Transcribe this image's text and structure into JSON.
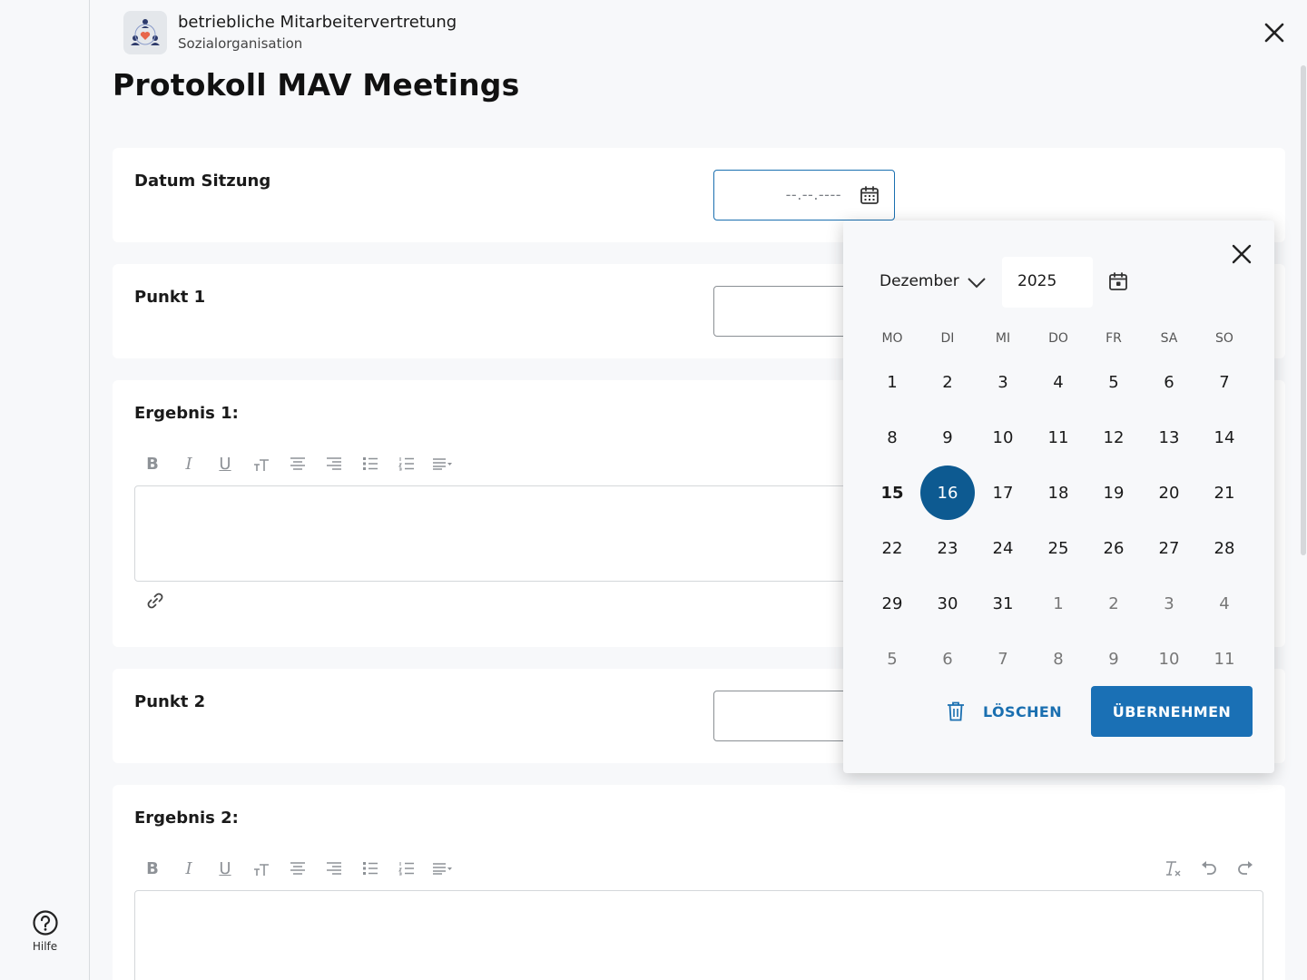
{
  "header": {
    "app_name": "betriebliche Mitarbeitervertretung",
    "app_subtitle": "Sozialorganisation",
    "page_title": "Protokoll MAV Meetings"
  },
  "sidebar": {
    "help_label": "Hilfe"
  },
  "form": {
    "date_label": "Datum Sitzung",
    "date_placeholder": "--.--.----",
    "punkt1_label": "Punkt 1",
    "ergebnis1_label": "Ergebnis 1:",
    "punkt2_label": "Punkt 2",
    "ergebnis2_label": "Ergebnis 2:"
  },
  "toolbar": {
    "bold": "B",
    "italic": "I",
    "underline": "U",
    "text_size": "T"
  },
  "datepicker": {
    "month": "Dezember",
    "year": "2025",
    "weekdays": [
      "MO",
      "DI",
      "MI",
      "DO",
      "FR",
      "SA",
      "SO"
    ],
    "weeks": [
      [
        "1",
        "2",
        "3",
        "4",
        "5",
        "6",
        "7"
      ],
      [
        "8",
        "9",
        "10",
        "11",
        "12",
        "13",
        "14"
      ],
      [
        "15",
        "16",
        "17",
        "18",
        "19",
        "20",
        "21"
      ],
      [
        "22",
        "23",
        "24",
        "25",
        "26",
        "27",
        "28"
      ],
      [
        "29",
        "30",
        "31",
        "1",
        "2",
        "3",
        "4"
      ],
      [
        "5",
        "6",
        "7",
        "8",
        "9",
        "10",
        "11"
      ]
    ],
    "today": "15",
    "selected": "16",
    "clear_label": "LÖSCHEN",
    "apply_label": "ÜBERNEHMEN"
  },
  "colors": {
    "accent": "#1a70b5",
    "selected_day": "#0d5a91",
    "background": "#f7f8fa"
  }
}
